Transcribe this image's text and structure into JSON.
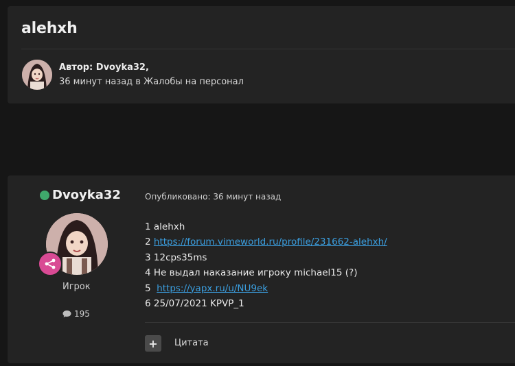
{
  "topic": {
    "title": "alehxh",
    "author_line": "Автор: Dvoyka32,",
    "meta_line": "36 минут назад в Жалобы на персонал"
  },
  "post": {
    "username": "Dvoyka32",
    "rank": "Игрок",
    "post_count": "195",
    "posted": "Опубликовано: 36 минут назад",
    "lines": [
      {
        "prefix": "1 ",
        "text": "alehxh",
        "link": ""
      },
      {
        "prefix": "2 ",
        "text": "",
        "link": "https://forum.vimeworld.ru/profile/231662-alehxh/"
      },
      {
        "prefix": "3 ",
        "text": "12cps35ms",
        "link": ""
      },
      {
        "prefix": "4 ",
        "text": "Не выдал наказание игроку michael15 (?)",
        "link": ""
      },
      {
        "prefix": "5  ",
        "text": "",
        "link": "https://yapx.ru/u/NU9ek"
      },
      {
        "prefix": "6 ",
        "text": "25/07/2021 KPVP_1",
        "link": ""
      }
    ],
    "quote_label": "Цитата",
    "quote_icon": "+"
  },
  "colors": {
    "background": "#161616",
    "card": "#232323",
    "link": "#3b9fe0",
    "online": "#3fa86b",
    "badge": "#d94a94"
  },
  "icons": {
    "online": "online-status-icon",
    "role": "share-network-icon",
    "posts": "comment-bubble-icon",
    "quote": "plus-icon"
  }
}
